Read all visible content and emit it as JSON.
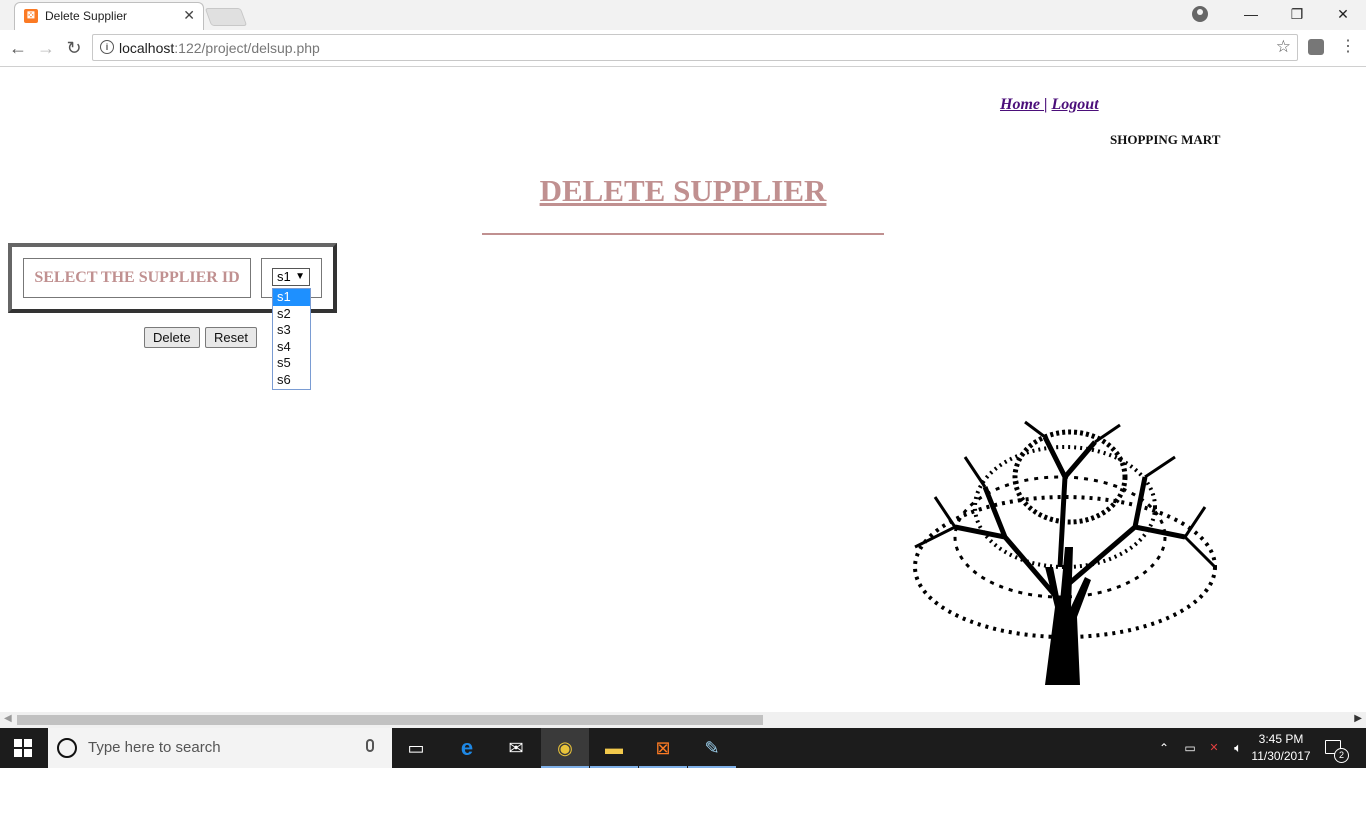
{
  "browser": {
    "tab_title": "Delete Supplier",
    "url_host": "localhost",
    "url_rest": ":122/project/delsup.php",
    "icons": [
      "back-icon",
      "forward-icon",
      "reload-icon",
      "info-icon",
      "star-icon",
      "menu-icon"
    ]
  },
  "nav": {
    "home": "Home ",
    "separator": "|",
    "logout": "Logout"
  },
  "brand": "SHOPPING MART",
  "heading": "DELETE SUPPLIER",
  "form": {
    "label": "SELECT THE SUPPLIER ID",
    "selected": "s1",
    "options": [
      "s1",
      "s2",
      "s3",
      "s4",
      "s5",
      "s6"
    ],
    "delete_label": "Delete",
    "reset_label": "Reset"
  },
  "taskbar": {
    "search_placeholder": "Type here to search",
    "time": "3:45 PM",
    "date": "11/30/2017",
    "notifications": "2"
  },
  "colors": {
    "heading": "#c09090",
    "link": "#4b0f7a",
    "dropdown_highlight": "#1e90ff"
  }
}
